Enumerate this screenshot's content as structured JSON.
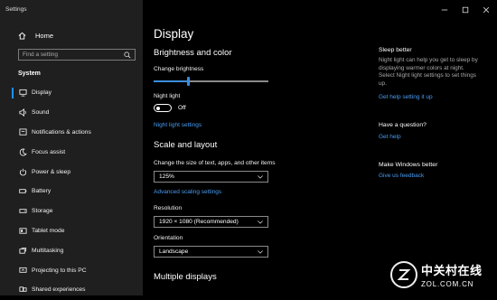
{
  "window": {
    "title": "Settings"
  },
  "sidebar": {
    "home_label": "Home",
    "search_placeholder": "Find a setting",
    "section_title": "System",
    "items": [
      {
        "label": "Display",
        "icon": "monitor-icon",
        "active": true
      },
      {
        "label": "Sound",
        "icon": "speaker-icon"
      },
      {
        "label": "Notifications & actions",
        "icon": "notifications-icon"
      },
      {
        "label": "Focus assist",
        "icon": "moon-icon"
      },
      {
        "label": "Power & sleep",
        "icon": "power-icon"
      },
      {
        "label": "Battery",
        "icon": "battery-icon"
      },
      {
        "label": "Storage",
        "icon": "storage-icon"
      },
      {
        "label": "Tablet mode",
        "icon": "tablet-icon"
      },
      {
        "label": "Multitasking",
        "icon": "multitasking-icon"
      },
      {
        "label": "Projecting to this PC",
        "icon": "projecting-icon"
      },
      {
        "label": "Shared experiences",
        "icon": "shared-experiences-icon"
      }
    ]
  },
  "main": {
    "page_title": "Display",
    "brightness_heading": "Brightness and color",
    "brightness_label": "Change brightness",
    "brightness_value": 0.3,
    "night_light_label": "Night light",
    "night_light_state": "Off",
    "night_light_settings_link": "Night light settings",
    "scale_heading": "Scale and layout",
    "scale_label": "Change the size of text, apps, and other items",
    "scale_value": "125%",
    "advanced_scaling_link": "Advanced scaling settings",
    "resolution_label": "Resolution",
    "resolution_value": "1920 × 1080 (Recommended)",
    "orientation_label": "Orientation",
    "orientation_value": "Landscape",
    "multiple_displays_heading": "Multiple displays"
  },
  "aside": {
    "sleep_title": "Sleep better",
    "sleep_text": "Night light can help you get to sleep by displaying warmer colors at night. Select Night light settings to set things up.",
    "sleep_link": "Get help setting it up",
    "question_title": "Have a question?",
    "question_link": "Get help",
    "better_title": "Make Windows better",
    "better_link": "Give us feedback"
  },
  "watermark": {
    "cn": "中关村在线",
    "en": "ZOL.COM.CN"
  },
  "colors": {
    "accent": "#3c8ddb",
    "link": "#4a9cf2",
    "sidebar_bg": "#1f1f1f",
    "main_bg": "#000000"
  }
}
